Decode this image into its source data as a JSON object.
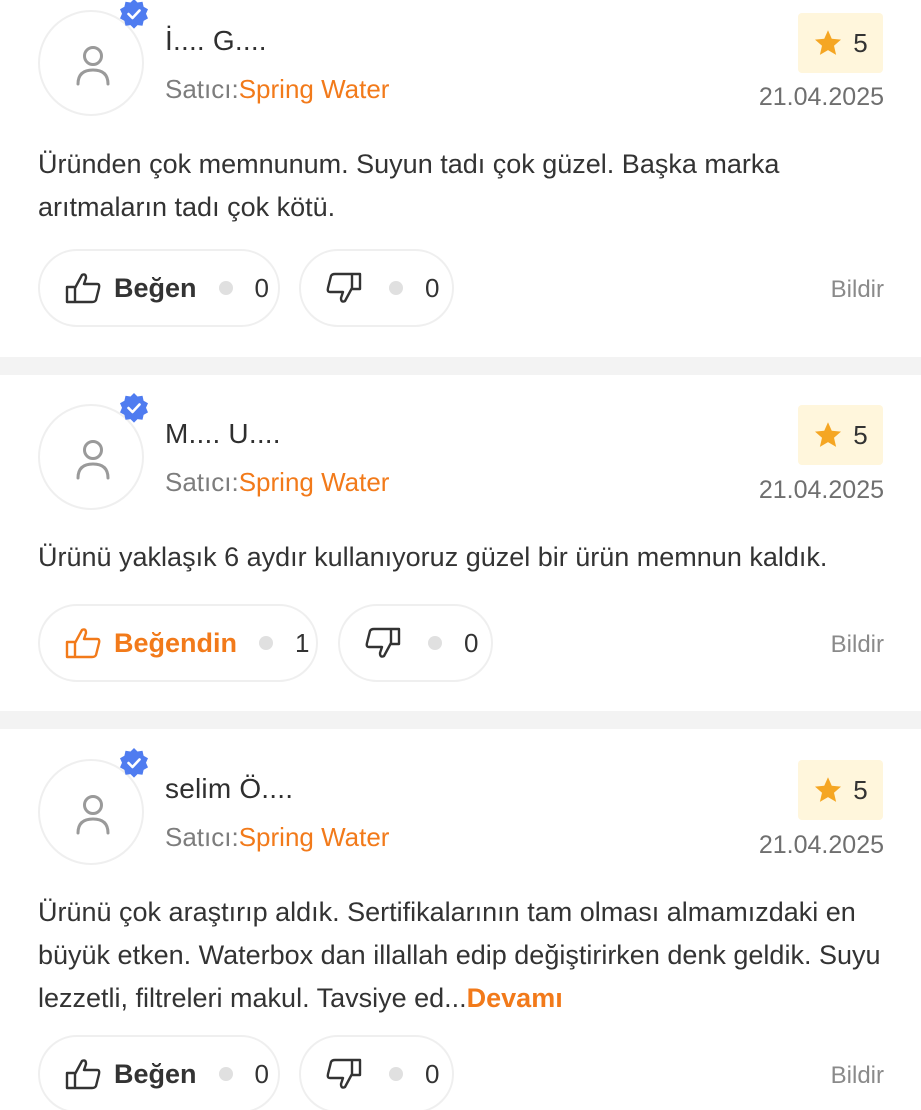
{
  "reviews": [
    {
      "user": "İ.... G....",
      "seller_prefix": "Satıcı:",
      "seller_name": "Spring Water",
      "rating": "5",
      "date": "21.04.2025",
      "comment": "Üründen çok memnunum. Suyun tadı çok güzel. Başka marka arıtmaların tadı çok kötü.",
      "more": "",
      "like_label": "Beğen",
      "like_count": "0",
      "liked": false,
      "dislike_count": "0",
      "report": "Bildir"
    },
    {
      "user": "M.... U....",
      "seller_prefix": "Satıcı:",
      "seller_name": "Spring Water",
      "rating": "5",
      "date": "21.04.2025",
      "comment": "Ürünü yaklaşık 6 aydır kullanıyoruz güzel bir ürün memnun kaldık.",
      "more": "",
      "like_label": "Beğendin",
      "like_count": "1",
      "liked": true,
      "dislike_count": "0",
      "report": "Bildir"
    },
    {
      "user": "selim Ö....",
      "seller_prefix": "Satıcı:",
      "seller_name": "Spring Water",
      "rating": "5",
      "date": "21.04.2025",
      "comment": "Ürünü çok araştırıp aldık. Sertifikalarının tam olması almamızdaki en büyük etken. Waterbox dan illallah edip değiştirirken denk geldik. Suyu lezzetli, filtreleri makul. Tavsiye ed...",
      "more": "Devamı",
      "like_label": "Beğen",
      "like_count": "0",
      "liked": false,
      "dislike_count": "0",
      "report": "Bildir"
    }
  ],
  "colors": {
    "accent": "#f27a1a",
    "verified": "#4f7cf0",
    "star": "#f5a623",
    "rating_bg": "#fff6dc",
    "divider": "#f3f3f3"
  },
  "icons": {
    "avatar": "person-icon",
    "verified": "verified-badge-icon",
    "star": "star-icon",
    "like": "thumbs-up-icon",
    "dislike": "thumbs-down-icon"
  }
}
